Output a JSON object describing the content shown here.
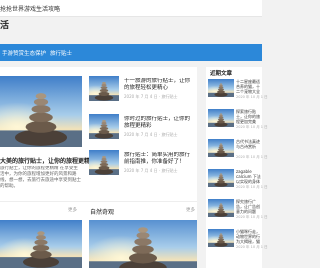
{
  "site": {
    "title": "抢抢世界游戏生活攻略",
    "brand": "活"
  },
  "nav": {
    "items": [
      {
        "label": "手游赞赏"
      },
      {
        "label": "生态保护"
      },
      {
        "label": "旅行贴士"
      }
    ]
  },
  "hero": {
    "title": "大美的旅行贴士，让你的旅程更精精",
    "desc": "旅行贴士，让你的旅程更精精 在享受生活中，为你的旅程增加更好的风景和路线，想一想，去旅行去旅途中享受到贴士的帮助。"
  },
  "cards": [
    {
      "title": "十一旅游的旅行贴士，让你的旅程轻松更精心",
      "meta": "2020 年 7 月 4 日 · 旅行贴士"
    },
    {
      "title": "你时过的旅行贴士，让你的旅程更精彩",
      "meta": "2020 年 7 月 4 日 · 旅行贴士"
    },
    {
      "title": "旅行贴士：简单实用的旅行前指南推，你准备好了！",
      "meta": "2020 年 7 月 4 日 · 旅行贴士"
    }
  ],
  "sections": {
    "left_more": "更多",
    "recommend_title": "自然奇观",
    "recommend_more": "更多"
  },
  "sidebar": {
    "title": "近期文章",
    "items": [
      {
        "title": "十二星座最适合养的猫，十二个宠物大全",
        "date": "2020 年 10 月 1 日"
      },
      {
        "title": "探索旅行贴士，让你的旅程更加完美",
        "date": "2020 年 10 月 1 日"
      },
      {
        "title": "古代书法真迹与古诗赏析",
        "date": "2020 年 10 月 1 日"
      },
      {
        "title": "zagable calcium 下法以实现的身体健康",
        "date": "2020 年 10 月 1 日"
      },
      {
        "title": "探究旅行广告，让广告创意力的问题",
        "date": "2020 年 10 月 1 日"
      },
      {
        "title": "小猫咪行走，动物世界的行为大揭秘，猫咪奇妙的行为",
        "date": "2020 年 10 月 1 日"
      }
    ]
  },
  "colors": {
    "nav_bg": "#2c88d9",
    "page_bg": "#f2f2f2"
  }
}
